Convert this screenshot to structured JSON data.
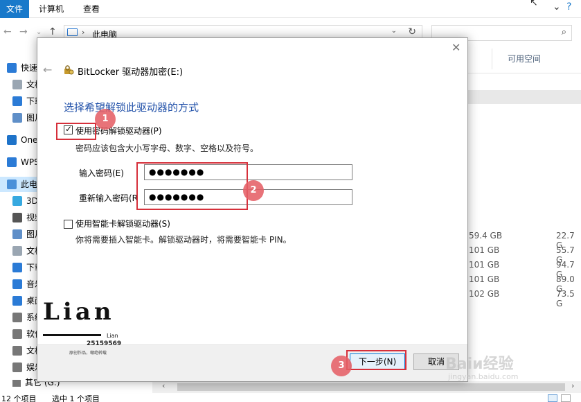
{
  "ribbon": {
    "tabs": [
      "文件",
      "计算机",
      "查看"
    ]
  },
  "address": {
    "path": "此电脑",
    "separator": "›"
  },
  "sidebar": {
    "items": [
      {
        "label": "快速",
        "kind": "quick",
        "color": "#2b7bd6"
      },
      {
        "label": "文档",
        "kind": "sub",
        "color": "#9aa6b2"
      },
      {
        "label": "下载",
        "kind": "sub",
        "color": "#2b7bd6"
      },
      {
        "label": "图片",
        "kind": "sub",
        "color": "#5f8fc8"
      },
      {
        "label": "One",
        "kind": "top",
        "color": "#1e73c9"
      },
      {
        "label": "WPS",
        "kind": "top",
        "color": "#2b7bd6"
      },
      {
        "label": "此电",
        "kind": "top-selected",
        "color": "#4a90d9"
      },
      {
        "label": "3D",
        "kind": "sub",
        "color": "#37a9e0"
      },
      {
        "label": "视频",
        "kind": "sub",
        "color": "#555"
      },
      {
        "label": "图片",
        "kind": "sub",
        "color": "#5f8fc8"
      },
      {
        "label": "文档",
        "kind": "sub",
        "color": "#9aa6b2"
      },
      {
        "label": "下载",
        "kind": "sub",
        "color": "#2b7bd6"
      },
      {
        "label": "音乐",
        "kind": "sub",
        "color": "#2b7bd6"
      },
      {
        "label": "桌面",
        "kind": "sub",
        "color": "#2b7bd6"
      },
      {
        "label": "系统",
        "kind": "sub",
        "color": "#777"
      },
      {
        "label": "软件",
        "kind": "sub",
        "color": "#777"
      },
      {
        "label": "文档",
        "kind": "sub",
        "color": "#777"
      },
      {
        "label": "娱乐",
        "kind": "sub",
        "color": "#777"
      }
    ],
    "bottom_item": "其它 (G:)"
  },
  "columns": {
    "free_space": "可用空间"
  },
  "drives": [
    {
      "total": "59.4 GB",
      "free": "22.7 G"
    },
    {
      "total": "101 GB",
      "free": "55.7 G"
    },
    {
      "total": "101 GB",
      "free": "94.7 G"
    },
    {
      "total": "101 GB",
      "free": "89.0 G"
    },
    {
      "total": "102 GB",
      "free": "73.5 G"
    }
  ],
  "status": {
    "count": "12 个项目",
    "selected": "选中 1 个项目"
  },
  "dialog": {
    "title": "BitLocker 驱动器加密(E:)",
    "heading": "选择希望解锁此驱动器的方式",
    "password_option": {
      "label": "使用密码解锁驱动器(P)",
      "checked": true,
      "note": "密码应该包含大小写字母、数字、空格以及符号。"
    },
    "enter_password_label": "输入密码(E)",
    "reenter_password_label": "重新输入密码(R",
    "password_value": "●●●●●●●",
    "reenter_value": "●●●●●●●",
    "smartcard_option": {
      "label": "使用智能卡解锁驱动器(S)",
      "checked": false,
      "note": "你将需要插入智能卡。解锁驱动器时，将需要智能卡 PIN。"
    },
    "next_button": "下一步(N)",
    "cancel_button": "取消"
  },
  "annotations": {
    "badges": [
      "1",
      "2",
      "3"
    ],
    "color": "#d6303b"
  },
  "watermark": {
    "logo_text": "Lian",
    "sub_text": "Lian",
    "number": "25159569",
    "tagline": "原创作品，嘲绝转载"
  },
  "baidu": {
    "brand": "Baiи经验",
    "url": "jingyan.baidu.com"
  }
}
